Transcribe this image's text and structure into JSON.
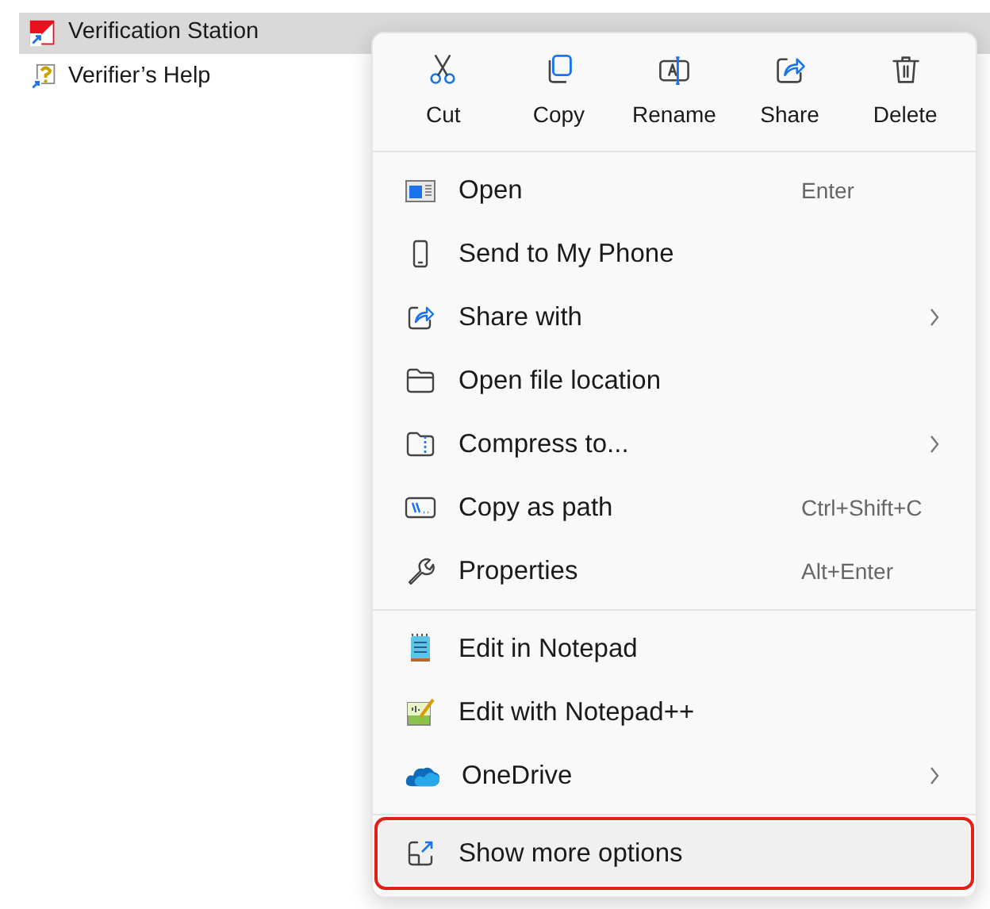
{
  "files": [
    {
      "name": "Verification Station",
      "selected": true,
      "kind": "app"
    },
    {
      "name": "Verifier’s Help",
      "selected": false,
      "kind": "help"
    }
  ],
  "context_menu": {
    "quick_actions": [
      {
        "label": "Cut",
        "kind": "cut"
      },
      {
        "label": "Copy",
        "kind": "copy"
      },
      {
        "label": "Rename",
        "kind": "rename"
      },
      {
        "label": "Share",
        "kind": "share"
      },
      {
        "label": "Delete",
        "kind": "delete"
      }
    ],
    "groups": [
      [
        {
          "label": "Open",
          "kind": "open",
          "shortcut": "Enter",
          "submenu": false
        },
        {
          "label": "Send to My Phone",
          "kind": "phone",
          "submenu": false
        },
        {
          "label": "Share with",
          "kind": "share",
          "submenu": true
        },
        {
          "label": "Open file location",
          "kind": "folder",
          "submenu": false
        },
        {
          "label": "Compress to...",
          "kind": "zip",
          "submenu": true
        },
        {
          "label": "Copy as path",
          "kind": "path",
          "shortcut": "Ctrl+Shift+C",
          "submenu": false
        },
        {
          "label": "Properties",
          "kind": "wrench",
          "shortcut": "Alt+Enter",
          "submenu": false
        }
      ],
      [
        {
          "label": "Edit in Notepad",
          "kind": "notepad",
          "submenu": false
        },
        {
          "label": "Edit with Notepad++",
          "kind": "notepadpp",
          "submenu": false
        },
        {
          "label": "OneDrive",
          "kind": "cloud",
          "submenu": true
        }
      ],
      [
        {
          "label": "Show more options",
          "kind": "more",
          "submenu": false,
          "highlighted": true
        }
      ]
    ]
  }
}
